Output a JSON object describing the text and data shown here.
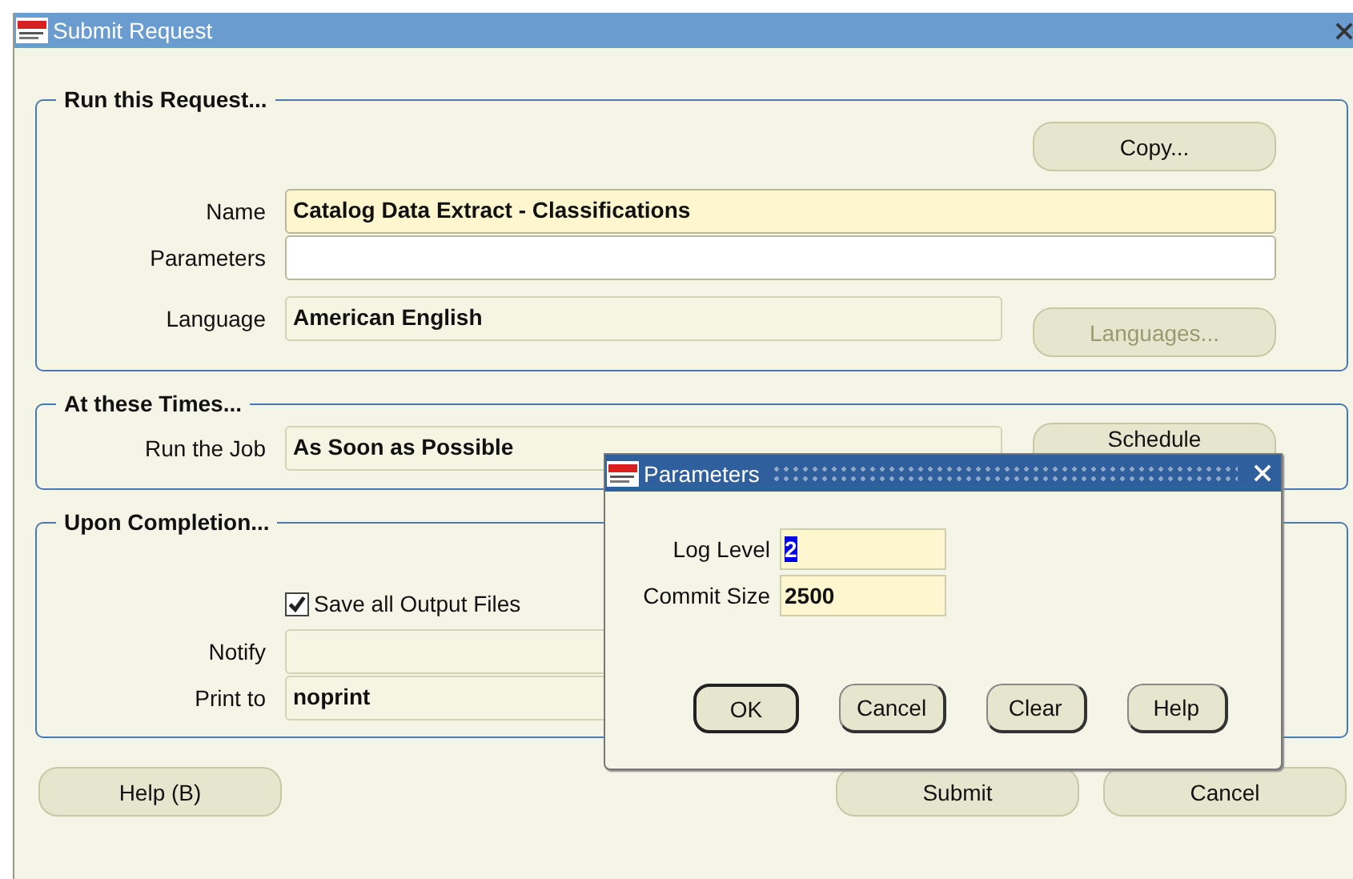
{
  "window": {
    "title": "Submit Request"
  },
  "sections": [
    {
      "title": "Run this Request...",
      "rows": [
        {
          "kind": "button",
          "button": {
            "label": "Copy...",
            "disabled": false
          }
        },
        {
          "kind": "field",
          "label": "Name",
          "value": "Catalog Data Extract - Classifications",
          "required": true,
          "readonly": false,
          "wide": true
        },
        {
          "kind": "field",
          "label": "Parameters",
          "required": false,
          "readonly": false,
          "wide": true
        },
        {
          "kind": "field",
          "label": "Language",
          "value": "American English",
          "required": false,
          "readonly": true,
          "wide": false,
          "button": {
            "label": "Languages...",
            "disabled": true
          }
        }
      ]
    },
    {
      "title": "At these Times...",
      "rows": [
        {
          "kind": "field",
          "label": "Run the Job",
          "value": "As Soon as Possible",
          "required": false,
          "readonly": true,
          "wide": false,
          "button": {
            "label": "Schedule",
            "disabled": false
          }
        }
      ]
    },
    {
      "title": "Upon Completion...",
      "rows": [
        {
          "kind": "checkbox",
          "label": "Save all Output Files",
          "checked": true
        },
        {
          "kind": "field",
          "label": "Notify",
          "required": false,
          "readonly": true,
          "wide": false
        },
        {
          "kind": "field",
          "label": "Print to",
          "value": "noprint",
          "required": false,
          "readonly": true,
          "wide": false
        }
      ]
    }
  ],
  "buttons": [
    {
      "label": "Help (B)",
      "disabled": false
    },
    {
      "label": "Submit",
      "disabled": false
    },
    {
      "label": "Cancel",
      "disabled": false
    }
  ],
  "dialog": {
    "title": "Parameters",
    "fields": [
      {
        "label": "Log Level",
        "value": "2",
        "selected": true
      },
      {
        "label": "Commit Size",
        "value": "2500",
        "selected": false
      }
    ],
    "buttons": [
      {
        "label": "OK",
        "default": true
      },
      {
        "label": "Cancel",
        "default": false
      },
      {
        "label": "Clear",
        "default": false
      },
      {
        "label": "Help",
        "default": false
      }
    ]
  }
}
